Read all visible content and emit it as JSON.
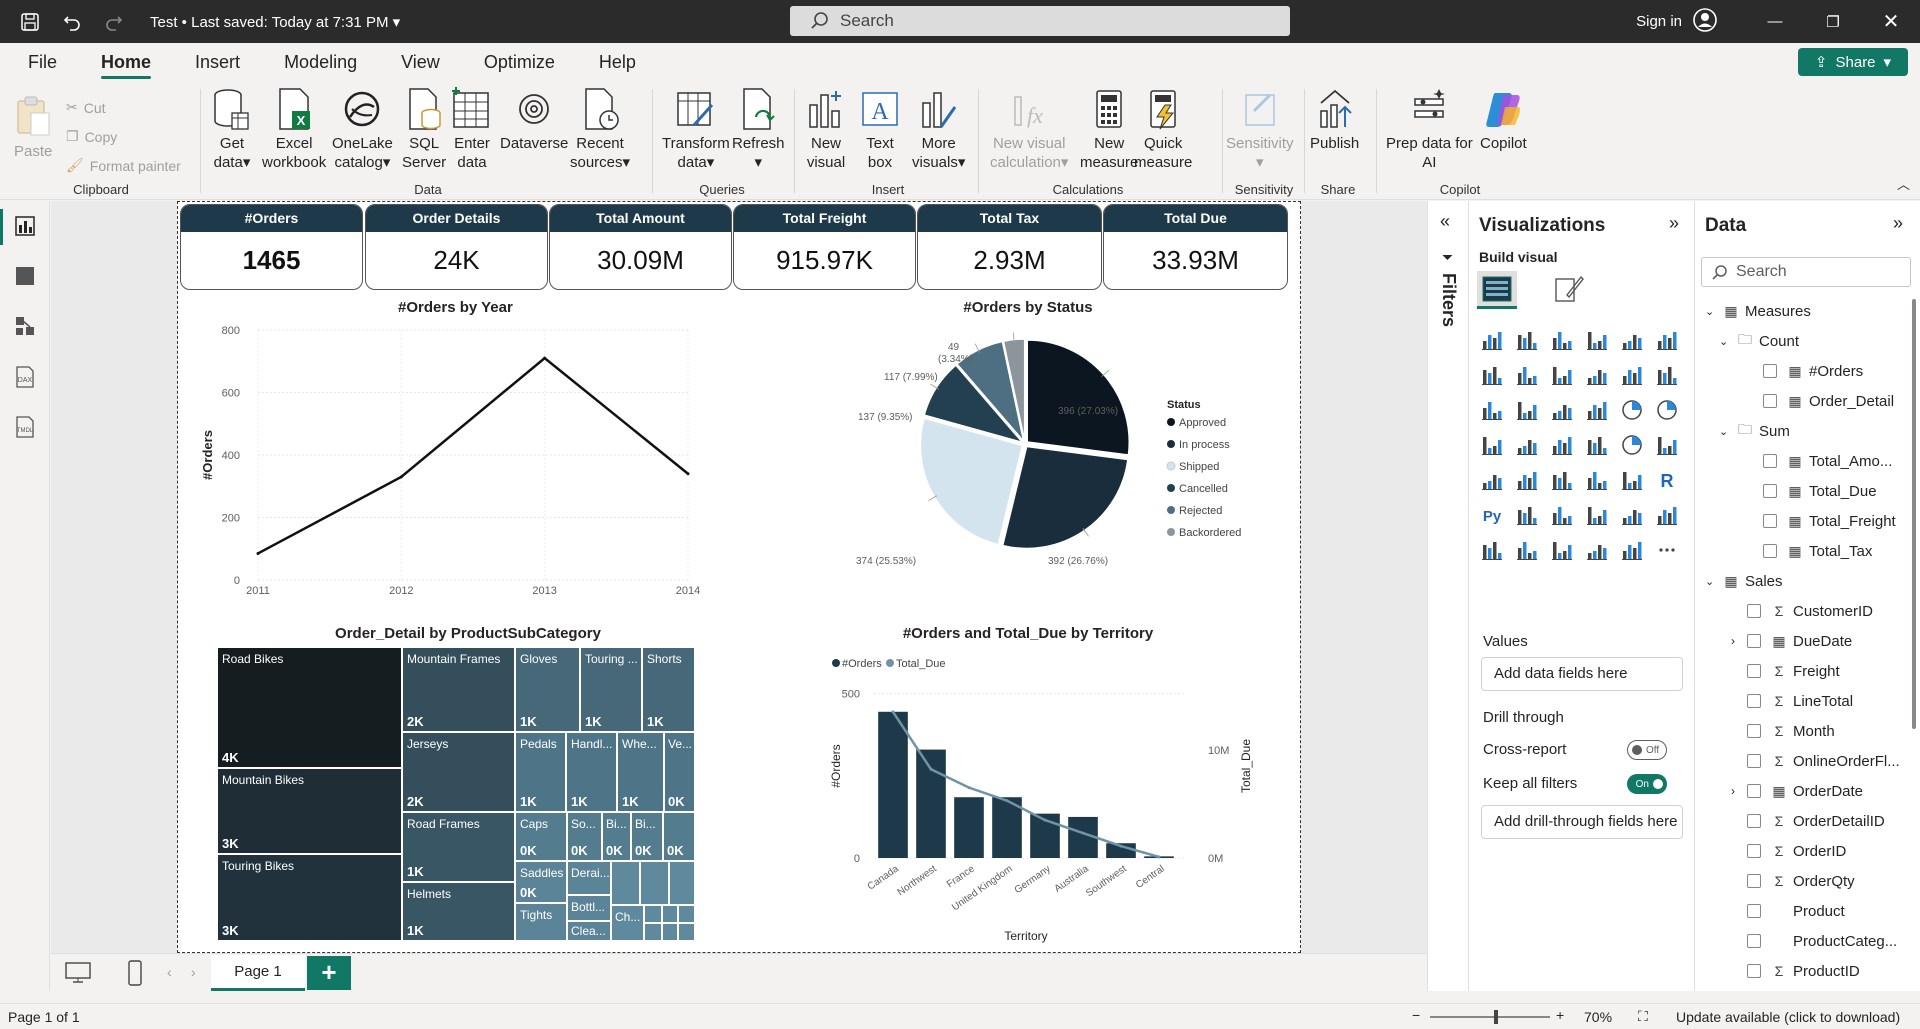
{
  "titlebar": {
    "file_title": "Test",
    "saved": " • Last saved: Today at 7:31 PM",
    "search_placeholder": "Search",
    "sign_in": "Sign in"
  },
  "menu": {
    "tabs": [
      "File",
      "Home",
      "Insert",
      "Modeling",
      "View",
      "Optimize",
      "Help"
    ],
    "active": "Home",
    "share": "Share"
  },
  "ribbon": {
    "clipboard": {
      "paste": "Paste",
      "cut": "Cut",
      "copy": "Copy",
      "format_painter": "Format painter",
      "label": "Clipboard"
    },
    "data": {
      "get_data_1": "Get",
      "get_data_2": "data",
      "excel_1": "Excel",
      "excel_2": "workbook",
      "onelake_1": "OneLake",
      "onelake_2": "catalog",
      "sql_1": "SQL",
      "sql_2": "Server",
      "enter_1": "Enter",
      "enter_2": "data",
      "dataverse": "Dataverse",
      "recent_1": "Recent",
      "recent_2": "sources",
      "label": "Data"
    },
    "queries": {
      "transform_1": "Transform",
      "transform_2": "data",
      "refresh": "Refresh",
      "label": "Queries"
    },
    "insert": {
      "new_visual_1": "New",
      "new_visual_2": "visual",
      "text_box_1": "Text",
      "text_box_2": "box",
      "more_visuals_1": "More",
      "more_visuals_2": "visuals",
      "label": "Insert"
    },
    "calculations": {
      "new_calc_1": "New visual",
      "new_calc_2": "calculation",
      "new_measure_1": "New",
      "new_measure_2": "measure",
      "quick_measure_1": "Quick",
      "quick_measure_2": "measure",
      "label": "Calculations"
    },
    "sensitivity": {
      "btn": "Sensitivity",
      "label": "Sensitivity"
    },
    "share": {
      "publish": "Publish",
      "label": "Share"
    },
    "copilot": {
      "prep_1": "Prep data for",
      "prep_2": "AI",
      "copilot": "Copilot",
      "label": "Copilot"
    }
  },
  "kpis": [
    {
      "title": "#Orders",
      "value": "1465"
    },
    {
      "title": "Order Details",
      "value": "24K"
    },
    {
      "title": "Total Amount",
      "value": "30.09M"
    },
    {
      "title": "Total Freight",
      "value": "915.97K"
    },
    {
      "title": "Total Tax",
      "value": "2.93M"
    },
    {
      "title": "Total Due",
      "value": "33.93M"
    }
  ],
  "chart_data": [
    {
      "type": "line",
      "title": "#Orders by Year",
      "x": [
        2011,
        2012,
        2013,
        2014
      ],
      "values": [
        85,
        330,
        710,
        340
      ],
      "ylabel": "#Orders",
      "xlabel": "",
      "ylim": [
        0,
        800
      ],
      "yticks": [
        0,
        200,
        400,
        600,
        800
      ],
      "grid": true
    },
    {
      "type": "pie",
      "title": "#Orders by Status",
      "legend_title": "Status",
      "legend_position": "right",
      "slices": [
        {
          "name": "Approved",
          "value": 396,
          "label": "396 (27.03%)",
          "color": "#0b1620"
        },
        {
          "name": "In process",
          "value": 392,
          "label": "392 (26.76%)",
          "color": "#1a2d3d"
        },
        {
          "name": "Shipped",
          "value": 374,
          "label": "374 (25.53%)",
          "color": "#d3e4ef"
        },
        {
          "name": "Cancelled",
          "value": 137,
          "label": "137 (9.35%)",
          "color": "#22404f"
        },
        {
          "name": "Rejected",
          "value": 117,
          "label": "117 (7.99%)",
          "color": "#4e6f81"
        },
        {
          "name": "Backordered",
          "value": 49,
          "label_1": "49",
          "label_2": "(3.34%)",
          "color": "#8c959b"
        }
      ]
    },
    {
      "type": "treemap",
      "title": "Order_Detail by ProductSubCategory",
      "items": [
        {
          "name": "Road Bikes",
          "value": "4K"
        },
        {
          "name": "Mountain Bikes",
          "value": "3K"
        },
        {
          "name": "Touring Bikes",
          "value": "3K"
        },
        {
          "name": "Mountain Frames",
          "value": "2K"
        },
        {
          "name": "Jerseys",
          "value": "2K"
        },
        {
          "name": "Road Frames",
          "value": "1K"
        },
        {
          "name": "Helmets",
          "value": "1K"
        },
        {
          "name": "Gloves",
          "value": "1K"
        },
        {
          "name": "Touring ...",
          "value": "1K"
        },
        {
          "name": "Shorts",
          "value": "1K"
        },
        {
          "name": "Pedals",
          "value": "1K"
        },
        {
          "name": "Handl...",
          "value": "1K"
        },
        {
          "name": "Whe...",
          "value": "1K"
        },
        {
          "name": "Ve...",
          "value": "0K"
        },
        {
          "name": "Caps",
          "value": "0K"
        },
        {
          "name": "So...",
          "value": "0K"
        },
        {
          "name": "Bi...",
          "value": "0K"
        },
        {
          "name": "Bi...",
          "value": "0K"
        },
        {
          "name": "Saddles",
          "value": "0K"
        },
        {
          "name": "Derai...",
          "value": ""
        },
        {
          "name": "Tights",
          "value": ""
        },
        {
          "name": "Bottl...",
          "value": ""
        },
        {
          "name": "Ch...",
          "value": ""
        },
        {
          "name": "Clea...",
          "value": ""
        }
      ]
    },
    {
      "type": "bar",
      "title": "#Orders and Total_Due by Territory",
      "categories": [
        "Canada",
        "Northwest",
        "France",
        "United Kingdom",
        "Germany",
        "Australia",
        "Southwest",
        "Central"
      ],
      "series": [
        {
          "name": "#Orders",
          "values": [
            445,
            330,
            185,
            185,
            135,
            125,
            45,
            5
          ],
          "color": "#1e3a4a"
        },
        {
          "name": "Total_Due",
          "values": [
            13.5,
            8.2,
            6.5,
            5.3,
            3.5,
            2.3,
            1.1,
            0.1
          ],
          "color": "#6f93a8"
        }
      ],
      "xlabel": "Territory",
      "ylabel": "#Orders",
      "y2label": "Total_Due",
      "yticks": [
        "0",
        "500"
      ],
      "y2ticks": [
        "0M",
        "10M"
      ],
      "ylim": [
        0,
        560
      ],
      "y2lim": [
        0,
        17
      ],
      "legend_position": "top-left"
    }
  ],
  "filters": {
    "label": "Filters"
  },
  "viz": {
    "title": "Visualizations",
    "build_visual": "Build visual",
    "values_label": "Values",
    "values_well": "Add data fields here",
    "drill_through": "Drill through",
    "cross_report": "Cross-report",
    "cross_state": "Off",
    "keep_filters": "Keep all filters",
    "keep_state": "On",
    "drill_well": "Add drill-through fields here"
  },
  "data_pane": {
    "title": "Data",
    "search_placeholder": "Search",
    "tree": [
      {
        "label": "Measures",
        "level": 0,
        "kind": "table",
        "expand": "down"
      },
      {
        "label": "Count",
        "level": 1,
        "kind": "folder",
        "expand": "down"
      },
      {
        "label": "#Orders",
        "level": 2,
        "kind": "measure"
      },
      {
        "label": "Order_Detail",
        "level": 2,
        "kind": "measure"
      },
      {
        "label": "Sum",
        "level": 1,
        "kind": "folder",
        "expand": "down"
      },
      {
        "label": "Total_Amo...",
        "level": 2,
        "kind": "measure"
      },
      {
        "label": "Total_Due",
        "level": 2,
        "kind": "measure"
      },
      {
        "label": "Total_Freight",
        "level": 2,
        "kind": "measure"
      },
      {
        "label": "Total_Tax",
        "level": 2,
        "kind": "measure"
      },
      {
        "label": "Sales",
        "level": 0,
        "kind": "table",
        "expand": "down"
      },
      {
        "label": "CustomerID",
        "level": 3,
        "kind": "sum"
      },
      {
        "label": "DueDate",
        "level": 3,
        "kind": "date",
        "expand": "right"
      },
      {
        "label": "Freight",
        "level": 3,
        "kind": "sum"
      },
      {
        "label": "LineTotal",
        "level": 3,
        "kind": "sum"
      },
      {
        "label": "Month",
        "level": 3,
        "kind": "sum"
      },
      {
        "label": "OnlineOrderFl...",
        "level": 3,
        "kind": "sum"
      },
      {
        "label": "OrderDate",
        "level": 3,
        "kind": "date",
        "expand": "right"
      },
      {
        "label": "OrderDetailID",
        "level": 3,
        "kind": "sum"
      },
      {
        "label": "OrderID",
        "level": 3,
        "kind": "sum"
      },
      {
        "label": "OrderQty",
        "level": 3,
        "kind": "sum"
      },
      {
        "label": "Product",
        "level": 3,
        "kind": "text"
      },
      {
        "label": "ProductCateg...",
        "level": 3,
        "kind": "text"
      },
      {
        "label": "ProductID",
        "level": 3,
        "kind": "sum"
      }
    ]
  },
  "pages": {
    "tab": "Page 1",
    "add": "+"
  },
  "status": {
    "page": "Page 1 of 1",
    "zoom": "70%",
    "zoom_level": 0.55,
    "update": "Update available (click to download)"
  },
  "colors": {
    "accent": "#117865",
    "kpi_header": "#1e3a4a",
    "dark_bg": "#2b2b2b"
  }
}
